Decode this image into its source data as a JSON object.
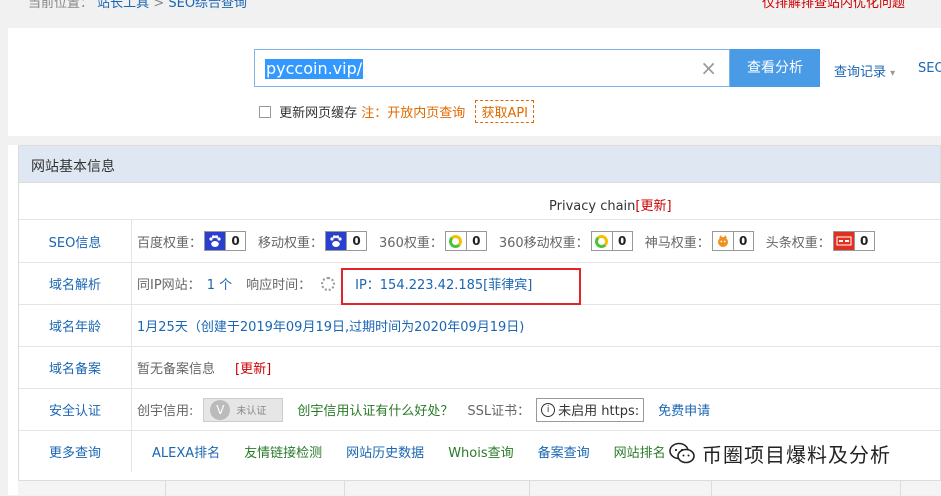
{
  "topbar": {
    "location_label": "当前位置：",
    "crumb_tools": "站长工具",
    "crumb_sep": ">",
    "crumb_page": "SEO综合查询",
    "right_text": "仅排解排查站内优化问题"
  },
  "search": {
    "value": "pyccoin.vip/",
    "clear_icon": "×",
    "analyze_label": "查看分析",
    "history_label": "查询记录",
    "history_caret": "▾",
    "seo_more_label": "SEO"
  },
  "options": {
    "refresh_cache_label": "更新网页缓存",
    "note": "注：开放内页查询",
    "api_label": "获取API"
  },
  "info": {
    "title": "网站基本信息",
    "site_title": "Privacy chain",
    "update_label": "[更新]",
    "rows": {
      "seo": {
        "label": "SEO信息",
        "items": [
          {
            "name": "百度权重：",
            "value": "0",
            "icon": "baidu-paw-icon"
          },
          {
            "name": "移动权重：",
            "value": "0",
            "icon": "baidu-paw-icon"
          },
          {
            "name": "360权重：",
            "value": "0",
            "icon": "360-ring-icon"
          },
          {
            "name": "360移动权重：",
            "value": "0",
            "icon": "360-ring-icon"
          },
          {
            "name": "神马权重：",
            "value": "0",
            "icon": "shenma-icon"
          },
          {
            "name": "头条权重：",
            "value": "0",
            "icon": "toutiao-icon"
          }
        ]
      },
      "dns": {
        "label": "域名解析",
        "same_ip_label": "同IP网站：",
        "same_ip_count": "1 个",
        "response_label": "响应时间：",
        "ip_text": "IP：154.223.42.185[菲律宾]"
      },
      "age": {
        "label": "域名年龄",
        "text": "1月25天（创建于2019年09月19日,过期时间为2020年09月19日)"
      },
      "icp": {
        "label": "域名备案",
        "text": "暂无备案信息",
        "update_label": "[更新]"
      },
      "security": {
        "label": "安全认证",
        "credit_label": "创宇信用:",
        "badge_text": "未认证",
        "credit_link": "创宇信用认证有什么好处？",
        "ssl_label": "SSL证书：",
        "ssl_status": "未启用 https:",
        "apply_link": "免费申请"
      },
      "more": {
        "label": "更多查询",
        "links": [
          "ALEXA排名",
          "友情链接检测",
          "网站历史数据",
          "Whois查询",
          "备案查询",
          "网站排名"
        ]
      }
    }
  },
  "watermark": {
    "text": "币圈项目爆料及分析"
  }
}
